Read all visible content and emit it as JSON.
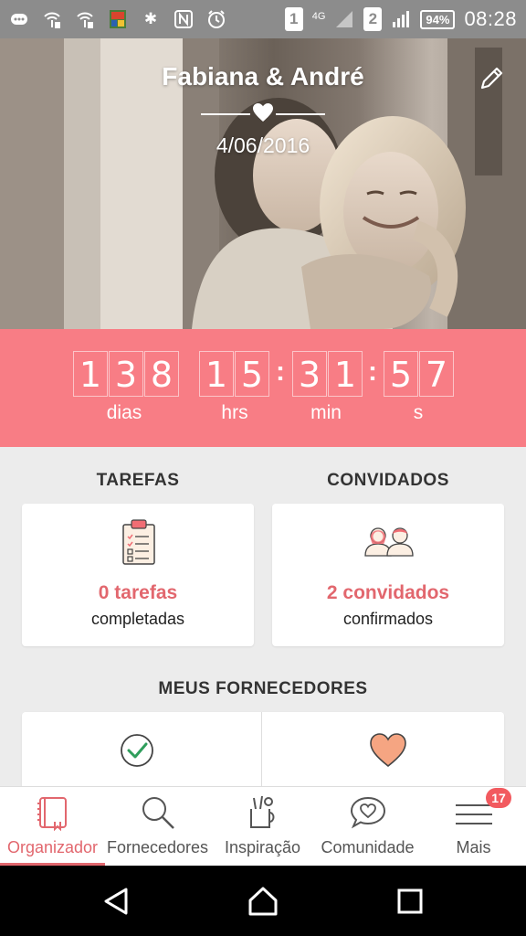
{
  "status_bar": {
    "sim1": "1",
    "sim2": "2",
    "network": "4G",
    "battery": "94%",
    "time": "08:28",
    "icons": [
      "messenger-icon",
      "wifi-signal-icon",
      "wifi-signal-icon",
      "app-thumbnail-icon",
      "bluetooth-icon",
      "nfc-icon",
      "alarm-icon"
    ]
  },
  "hero": {
    "couple_names": "Fabiana & André",
    "date": "4/06/2016"
  },
  "countdown": {
    "days": [
      "1",
      "3",
      "8"
    ],
    "hours": [
      "1",
      "5"
    ],
    "minutes": [
      "3",
      "1"
    ],
    "seconds": [
      "5",
      "7"
    ],
    "labels": {
      "days": "dias",
      "hours": "hrs",
      "minutes": "min",
      "seconds": "s"
    }
  },
  "tasks": {
    "title": "TAREFAS",
    "value": "0 tarefas",
    "subtitle": "completadas"
  },
  "guests": {
    "title": "CONVIDADOS",
    "value": "2 convidados",
    "subtitle": "confirmados"
  },
  "vendors": {
    "title": "MEUS FORNECEDORES"
  },
  "bottom_nav": {
    "items": [
      {
        "label": "Organizador",
        "icon": "notebook-icon",
        "active": true
      },
      {
        "label": "Fornecedores",
        "icon": "search-icon",
        "active": false
      },
      {
        "label": "Inspiração",
        "icon": "inspiration-icon",
        "active": false
      },
      {
        "label": "Comunidade",
        "icon": "chat-heart-icon",
        "active": false
      },
      {
        "label": "Mais",
        "icon": "menu-icon",
        "active": false
      }
    ],
    "mais_badge": "17"
  },
  "colors": {
    "accent": "#f87d85",
    "accent_text": "#e2676e",
    "check_green": "#2f9e5c",
    "heart_peach": "#f5a582"
  }
}
